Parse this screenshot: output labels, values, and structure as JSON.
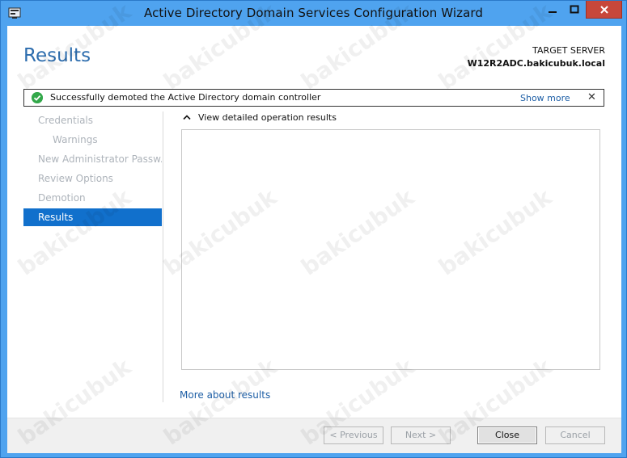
{
  "window": {
    "title": "Active Directory Domain Services Configuration Wizard"
  },
  "header": {
    "page_title": "Results",
    "target_label": "TARGET SERVER",
    "target_server": "W12R2ADC.bakicubuk.local"
  },
  "notification": {
    "message": "Successfully demoted the Active Directory domain controller",
    "show_more": "Show more",
    "close": "✕"
  },
  "sidebar": {
    "items": [
      {
        "label": "Credentials"
      },
      {
        "label": "Warnings"
      },
      {
        "label": "New Administrator Passw..."
      },
      {
        "label": "Review Options"
      },
      {
        "label": "Demotion"
      },
      {
        "label": "Results"
      }
    ]
  },
  "main": {
    "expander_label": "View detailed operation results",
    "more_link": "More about results"
  },
  "footer": {
    "previous": "< Previous",
    "next": "Next >",
    "close": "Close",
    "cancel": "Cancel"
  },
  "watermark": "bakicubuk",
  "colors": {
    "accent": "#1170cc",
    "title_blue": "#2d6dae",
    "window_frame": "#4fa3ef",
    "success_green": "#33a84a",
    "close_red": "#c7473a"
  }
}
